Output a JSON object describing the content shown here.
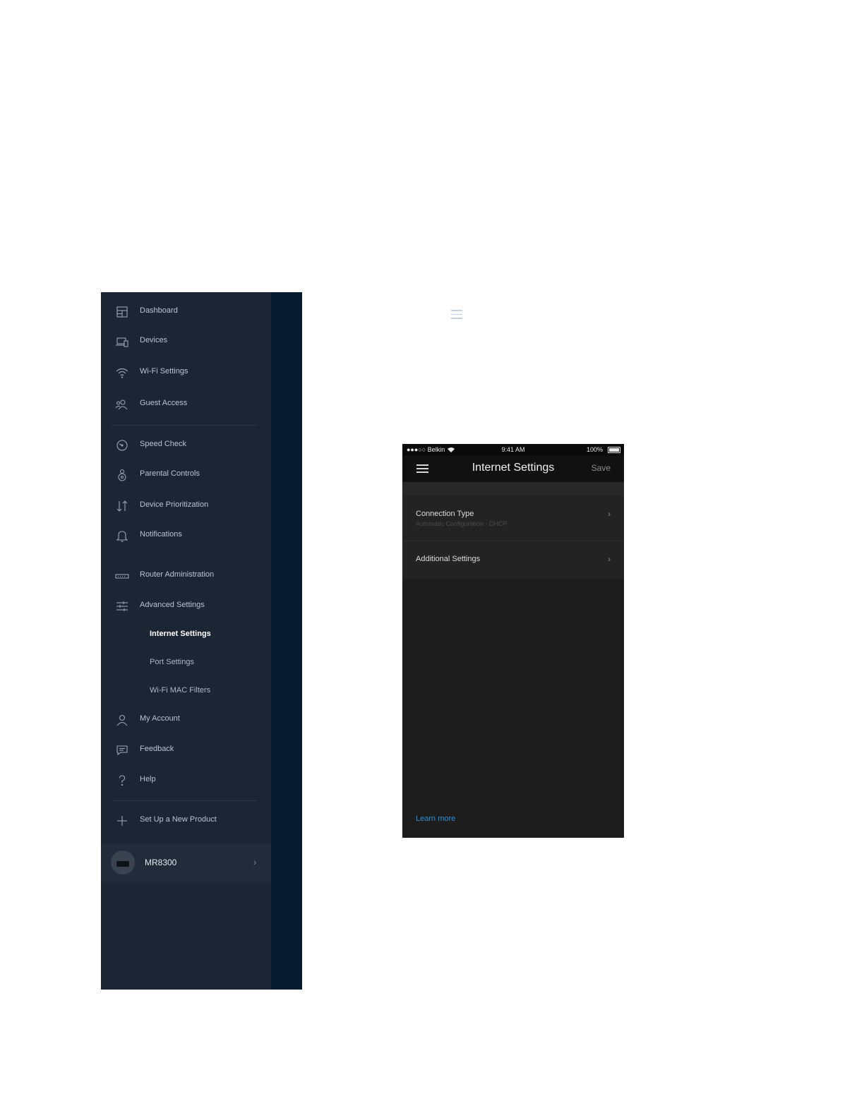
{
  "nav": {
    "items": [
      {
        "label": "Dashboard",
        "icon": "dashboard-icon"
      },
      {
        "label": "Devices",
        "icon": "devices-icon"
      },
      {
        "label": "Wi-Fi Settings",
        "icon": "wifi-icon"
      },
      {
        "label": "Guest Access",
        "icon": "guest-access-icon"
      },
      {
        "label": "Speed Check",
        "icon": "speed-check-icon"
      },
      {
        "label": "Parental Controls",
        "icon": "parental-controls-icon"
      },
      {
        "label": "Device Prioritization",
        "icon": "device-prioritization-icon"
      },
      {
        "label": "Notifications",
        "icon": "bell-icon"
      },
      {
        "label": "Router Administration",
        "icon": "router-icon"
      },
      {
        "label": "Advanced Settings",
        "icon": "sliders-icon"
      }
    ],
    "sub_items": [
      {
        "label": "Internet Settings",
        "active": true
      },
      {
        "label": "Port Settings",
        "active": false
      },
      {
        "label": "Wi-Fi MAC Filters",
        "active": false
      }
    ],
    "lower_items": [
      {
        "label": "My Account",
        "icon": "user-icon"
      },
      {
        "label": "Feedback",
        "icon": "feedback-icon"
      },
      {
        "label": "Help",
        "icon": "help-icon"
      },
      {
        "label": "Set Up a New Product",
        "icon": "plus-icon"
      }
    ],
    "product": {
      "label": "MR8300",
      "chevron": "›"
    },
    "colors": {
      "panel": "#1c2533",
      "strip": "#061a30"
    }
  },
  "phone": {
    "status": {
      "carrier": "●●●○○ Belkin",
      "time": "9:41 AM",
      "battery": "100%"
    },
    "header": {
      "title": "Internet Settings",
      "save_label": "Save"
    },
    "rows": [
      {
        "title": "Connection Type",
        "subtitle": "Automatic Configuration - DHCP",
        "chevron": "›"
      },
      {
        "title": "Additional Settings",
        "chevron": "›"
      }
    ],
    "learn_more": "Learn more",
    "colors": {
      "background": "#1d1d1d",
      "link": "#2d8ed6"
    }
  }
}
